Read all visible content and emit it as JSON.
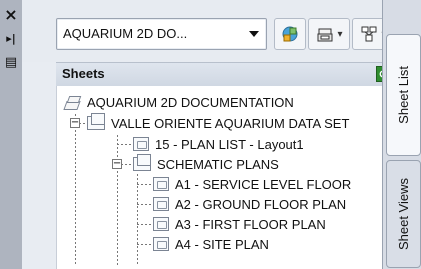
{
  "left_strip": {
    "close_glyph": "×",
    "autohide_glyph": "▸|",
    "properties_glyph": "▤"
  },
  "toolbar": {
    "sheet_set_combo_value": "AQUARIUM 2D DO...",
    "icons": [
      "sheet-set-icon",
      "publish-icon",
      "model-view-icon"
    ]
  },
  "sheets_panel": {
    "title": "Sheets"
  },
  "tree": {
    "root_label": "AQUARIUM 2D DOCUMENTATION",
    "sheet_set_label": "VALLE ORIENTE AQUARIUM DATA SET",
    "sheet_15_label": "15 - PLAN LIST - Layout1",
    "subset_label": "SCHEMATIC PLANS",
    "sheet_a1_label": "A1 - SERVICE LEVEL FLOOR",
    "sheet_a2_label": "A2 - GROUND FLOOR PLAN",
    "sheet_a3_label": "A3 - FIRST FLOOR PLAN",
    "sheet_a4_label": "A4 - SITE PLAN"
  },
  "tabs": {
    "sheet_list": "Sheet List",
    "sheet_views": "Sheet Views"
  }
}
